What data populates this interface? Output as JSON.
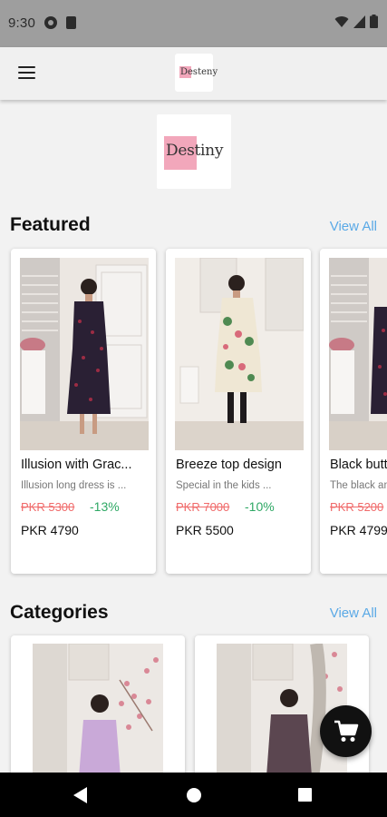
{
  "status_bar": {
    "time": "9:30"
  },
  "app_bar": {
    "logo_text": "Desteny"
  },
  "brand": {
    "logo_text": "Destiny"
  },
  "featured": {
    "title": "Featured",
    "view_all": "View All",
    "items": [
      {
        "name": "Illusion with Grac...",
        "desc": "Illusion long dress is ...",
        "old_price": "PKR 5300",
        "discount": "-13%",
        "price": "PKR 4790",
        "dress_color": "#2a2034",
        "pattern": "dots-red"
      },
      {
        "name": "Breeze top design",
        "desc": "Special in the kids ...",
        "old_price": "PKR 7000",
        "discount": "-10%",
        "price": "PKR 5500",
        "dress_color": "#efe7d4",
        "pattern": "floral-green"
      },
      {
        "name": "Black butt",
        "desc": "The black an",
        "old_price": "PKR 5200",
        "discount": "",
        "price": "PKR 4799",
        "dress_color": "#2a2034",
        "pattern": "dots-red"
      }
    ]
  },
  "categories": {
    "title": "Categories",
    "view_all": "View All",
    "items": [
      {
        "dress_color": "#c9a9d8"
      },
      {
        "dress_color": "#5b4650"
      }
    ]
  },
  "icons": {
    "menu": "menu-icon",
    "cart": "shopping-cart-icon",
    "back": "back-icon",
    "home": "home-icon",
    "recents": "recents-icon"
  }
}
